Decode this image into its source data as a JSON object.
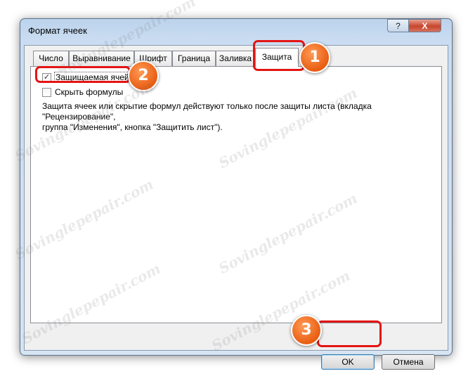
{
  "window": {
    "title": "Формат ячеек",
    "help_label": "?",
    "close_label": "X"
  },
  "tabs": [
    {
      "label": "Число"
    },
    {
      "label": "Выравнивание"
    },
    {
      "label": "Шрифт"
    },
    {
      "label": "Граница"
    },
    {
      "label": "Заливка"
    },
    {
      "label": "Защита"
    }
  ],
  "active_tab": "Защита",
  "protection": {
    "locked": {
      "label": "Защищаемая ячейка",
      "checked": true,
      "check_glyph": "✓"
    },
    "hidden": {
      "label": "Скрыть формулы",
      "checked": false
    },
    "description_line1": "Защита ячеек или скрытие формул действуют только после защиты листа (вкладка \"Рецензирование\",",
    "description_line2": "группа \"Изменения\", кнопка \"Защитить лист\")."
  },
  "buttons": {
    "ok": "OK",
    "cancel": "Отмена"
  },
  "annotations": {
    "step1": "1",
    "step2": "2",
    "step3": "3",
    "color": "#e41414",
    "badge_color": "#e85d12"
  },
  "watermark": "Sovinglepepair.com"
}
